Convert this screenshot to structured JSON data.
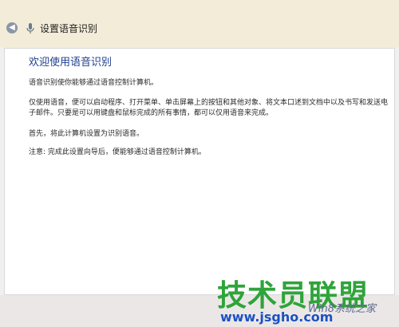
{
  "window": {
    "title": "设置语音识别",
    "back_icon": "back-arrow-icon",
    "app_icon": "microphone-icon"
  },
  "content": {
    "heading": "欢迎使用语音识别",
    "paragraphs": [
      "语音识别使你能够通过语音控制计算机。",
      "仅使用语音，便可以启动程序、打开菜单、单击屏幕上的按钮和其他对象、将文本口述到文档中以及书写和发送电子邮件。只要是可以用键盘和鼠标完成的所有事情，都可以仅用语音来完成。",
      "首先，将此计算机设置为识别语音。",
      "注意: 完成此设置向导后，便能够通过语音控制计算机。"
    ]
  },
  "watermark": {
    "brand": "技术员联盟",
    "site": "Win8系统之家",
    "url": "www.jsgho.com"
  },
  "colors": {
    "title_bar": "#f3ecd8",
    "heading": "#1f3f8f",
    "watermark_green": "#2ea43a",
    "watermark_blue": "#1a52c2"
  }
}
